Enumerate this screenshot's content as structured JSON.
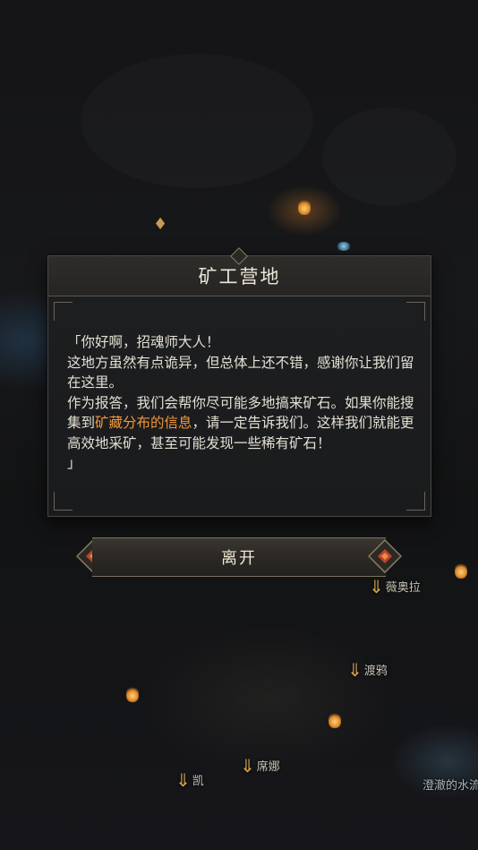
{
  "dialog": {
    "title": "矿工营地",
    "lines": {
      "open_quote": "「你好啊，招魂师大人！",
      "para1": "这地方虽然有点诡异，但总体上还不错，感谢你让我们留在这里。",
      "para2_before": "作为报答，我们会帮你尽可能多地搞来矿石。如果你能搜集到",
      "para2_highlight": "矿藏分布的信息",
      "para2_after": "，请一定告诉我们。这样我们就能更高效地采矿，甚至可能发现一些稀有矿石！",
      "close_quote": "」"
    }
  },
  "leave_button": {
    "label": "离开"
  },
  "map_labels": {
    "weiaola": "薇奥拉",
    "duya": "渡鸦",
    "xina": "席娜",
    "kai": "凯",
    "water": "澄澈的水流"
  },
  "colors": {
    "highlight": "#f0963a",
    "dialog_bg": "#1b1c1e",
    "title_text": "#ece6d8"
  },
  "icons": {
    "location": "location-pin-icon",
    "down_arrow": "down-arrow-marker-icon",
    "ornament": "diamond-ornament-icon"
  }
}
